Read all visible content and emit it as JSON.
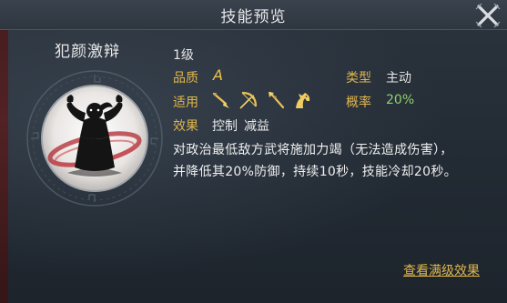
{
  "window": {
    "title": "技能预览",
    "close_icon": "close-x-icon"
  },
  "skill": {
    "name": "犯颜激辩",
    "level": "1级",
    "icon": "warrior-flexing-emblem",
    "quality_label": "品质",
    "quality_value": "A",
    "type_label": "类型",
    "type_value": "主动",
    "applies_label": "适用",
    "applies_icons": [
      "spear-icon",
      "bow-icon",
      "lance-icon",
      "horse-icon"
    ],
    "rate_label": "概率",
    "rate_value": "20%",
    "effect_label": "效果",
    "effect_tags": [
      "控制",
      "减益"
    ],
    "description_lines": [
      "对政治最低敌方武将施加力竭（无法造成伤害），",
      "并降低其20%防御，持续10秒，技能冷却20秒。"
    ]
  },
  "footer": {
    "max_level_link": "查看满级效果"
  },
  "colors": {
    "label_gold": "#e0b64a",
    "rate_green": "#8fd26b",
    "accent_red": "#a3202a"
  }
}
